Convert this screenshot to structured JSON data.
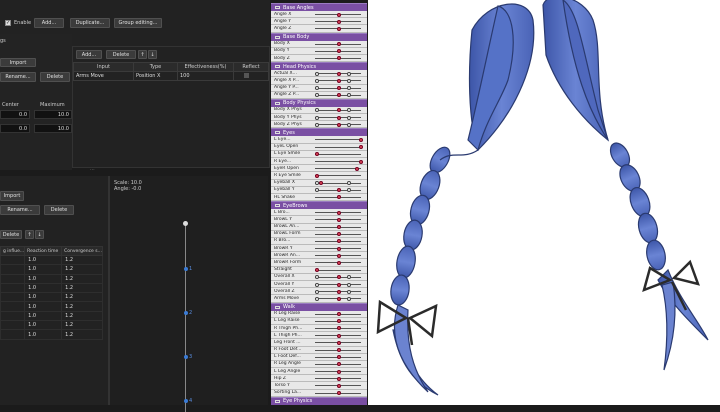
{
  "toolbar": {
    "enable_label": "Enable",
    "add_label": "Add...",
    "duplicate_label": "Duplicate...",
    "group_editing_label": "Group editing..."
  },
  "left_top": {
    "cut_label": "gs",
    "import_label": "Import",
    "rename_label": "Rename...",
    "delete_label": "Delete",
    "center_label": "Center",
    "maximum_label": "Maximum",
    "rows": [
      {
        "center": "0.0",
        "maximum": "10.0"
      },
      {
        "center": "0.0",
        "maximum": "10.0"
      }
    ]
  },
  "input_panel": {
    "add_label": "Add...",
    "delete_label": "Delete",
    "up_label": "↑",
    "down_label": "↓",
    "headers": [
      "Input",
      "Type",
      "Effectiveness(%)",
      "Reflect"
    ],
    "row": {
      "input": "Arms Move",
      "type": "Position X",
      "effectiveness": "100"
    }
  },
  "left_bottom": {
    "import_label": "Import",
    "rename_label": "Rename...",
    "delete_label": "Delete",
    "delete2_label": "Delete",
    "up_label": "↑",
    "down_label": "↓",
    "headers": [
      "g influe...",
      "Reaction time",
      "Convergence s..."
    ],
    "rows": [
      [
        "1.0",
        "1.2"
      ],
      [
        "1.0",
        "1.2"
      ],
      [
        "1.0",
        "1.2"
      ],
      [
        "1.0",
        "1.2"
      ],
      [
        "1.0",
        "1.2"
      ],
      [
        "1.0",
        "1.2"
      ],
      [
        "1.0",
        "1.2"
      ],
      [
        "1.0",
        "1.2"
      ],
      [
        "1.0",
        "1.2"
      ]
    ]
  },
  "timeline": {
    "scale": "Scale: 10.0",
    "angle": "Angle: -0.0",
    "nodes": [
      "1",
      "2",
      "3",
      "4"
    ]
  },
  "params_panel": {
    "groups": [
      {
        "name": "Base Angles",
        "items": [
          {
            "name": "Angle X",
            "knob": 0.5,
            "dots": false
          },
          {
            "name": "Angle Y",
            "knob": 0.5,
            "dots": false
          },
          {
            "name": "Angle Z",
            "knob": 0.5,
            "dots": false
          }
        ]
      },
      {
        "name": "Base Body",
        "items": [
          {
            "name": "Body X",
            "knob": 0.5,
            "dots": false
          },
          {
            "name": "Body Y",
            "knob": 0.5,
            "dots": false
          },
          {
            "name": "Body Z",
            "knob": 0.5,
            "dots": false
          }
        ]
      },
      {
        "name": "Head Physics",
        "items": [
          {
            "name": "Actual X...",
            "knob": 0.5,
            "dots": true
          },
          {
            "name": "Angle X P...",
            "knob": 0.5,
            "dots": true
          },
          {
            "name": "Angle Y P...",
            "knob": 0.5,
            "dots": true
          },
          {
            "name": "Angle Z P...",
            "knob": 0.5,
            "dots": true
          }
        ]
      },
      {
        "name": "Body Physics",
        "items": [
          {
            "name": "Body X Phys",
            "knob": 0.5,
            "dots": true
          },
          {
            "name": "Body Y Phys",
            "knob": 0.5,
            "dots": true
          },
          {
            "name": "Body Z Phys",
            "knob": 0.5,
            "dots": true
          }
        ]
      },
      {
        "name": "Eyes",
        "items": [
          {
            "name": "L Eye...",
            "knob": 1.0,
            "dots": false
          },
          {
            "name": "EyeL Open",
            "knob": 1.0,
            "dots": false
          },
          {
            "name": "L Eye Smile",
            "knob": 0.0,
            "dots": false
          },
          {
            "name": "R Eye...",
            "knob": 1.0,
            "dots": false
          },
          {
            "name": "EyeR Open",
            "knob": 0.9,
            "dots": false
          },
          {
            "name": "R Eye Smile",
            "knob": 0.0,
            "dots": false
          },
          {
            "name": "Eyeball X",
            "knob": 0.1,
            "dots": true
          },
          {
            "name": "Eyeball Y",
            "knob": 0.5,
            "dots": true
          },
          {
            "name": "HL Shake",
            "knob": 0.5,
            "dots": false
          }
        ]
      },
      {
        "name": "EyeBrows",
        "items": [
          {
            "name": "L Bro...",
            "knob": 0.5,
            "dots": false
          },
          {
            "name": "BrowL Y",
            "knob": 0.5,
            "dots": false
          },
          {
            "name": "BrowL An...",
            "knob": 0.5,
            "dots": false
          },
          {
            "name": "BrowL Form",
            "knob": 0.5,
            "dots": false
          },
          {
            "name": "R Bro...",
            "knob": 0.5,
            "dots": false
          },
          {
            "name": "BrowR Y",
            "knob": 0.5,
            "dots": false
          },
          {
            "name": "BrowR An...",
            "knob": 0.5,
            "dots": false
          },
          {
            "name": "BrowR Form",
            "knob": 0.5,
            "dots": false
          },
          {
            "name": "Straight",
            "knob": 0.0,
            "dots": false
          },
          {
            "name": "Overall X",
            "knob": 0.5,
            "dots": true
          },
          {
            "name": "Overall Y",
            "knob": 0.5,
            "dots": true
          },
          {
            "name": "Overall Z",
            "knob": 0.5,
            "dots": true
          },
          {
            "name": "Arms Move",
            "knob": 0.5,
            "dots": true
          }
        ]
      },
      {
        "name": "Walk",
        "items": [
          {
            "name": "R Leg Raise",
            "knob": 0.5,
            "dots": false
          },
          {
            "name": "L Leg Raise",
            "knob": 0.5,
            "dots": false
          },
          {
            "name": "R Thigh Ph...",
            "knob": 0.5,
            "dots": false
          },
          {
            "name": "L Thigh Ph...",
            "knob": 0.5,
            "dots": false
          },
          {
            "name": "Leg Front ...",
            "knob": 0.5,
            "dots": false
          },
          {
            "name": "R Foot Def...",
            "knob": 0.5,
            "dots": false
          },
          {
            "name": "L Foot Def...",
            "knob": 0.5,
            "dots": false
          },
          {
            "name": "R Leg Angle",
            "knob": 0.5,
            "dots": false
          },
          {
            "name": "L Leg Angle",
            "knob": 0.5,
            "dots": false
          },
          {
            "name": "Hip Z",
            "knob": 0.5,
            "dots": false
          },
          {
            "name": "Torso Y",
            "knob": 0.5,
            "dots": false
          },
          {
            "name": "Sorting La...",
            "knob": 0.5,
            "dots": false
          }
        ]
      },
      {
        "name": "Eye Physics",
        "items": []
      }
    ]
  },
  "colors": {
    "group_header": "#7a4fa3",
    "knob": "#e04a5a",
    "node": "#3a7bd5",
    "hair": "#5b74c4"
  }
}
